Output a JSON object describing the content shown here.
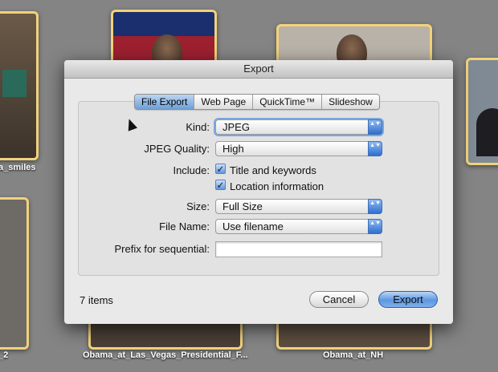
{
  "background": {
    "captions": [
      "a_smiles",
      "_2",
      "Obama_at_Las_Vegas_Presidential_F...",
      "Obama_at_NH"
    ]
  },
  "dialog": {
    "title": "Export",
    "tabs": [
      "File Export",
      "Web Page",
      "QuickTime™",
      "Slideshow"
    ],
    "active_tab": "File Export",
    "fields": {
      "kind_label": "Kind:",
      "kind_value": "JPEG",
      "quality_label": "JPEG Quality:",
      "quality_value": "High",
      "include_label": "Include:",
      "include_title": "Title and keywords",
      "include_location": "Location information",
      "size_label": "Size:",
      "size_value": "Full Size",
      "filename_label": "File Name:",
      "filename_value": "Use filename",
      "prefix_label": "Prefix for sequential:",
      "prefix_value": ""
    },
    "item_count": "7 items",
    "cancel_label": "Cancel",
    "export_label": "Export",
    "arrows_glyph": "▲▼",
    "check_glyph": "✓"
  }
}
